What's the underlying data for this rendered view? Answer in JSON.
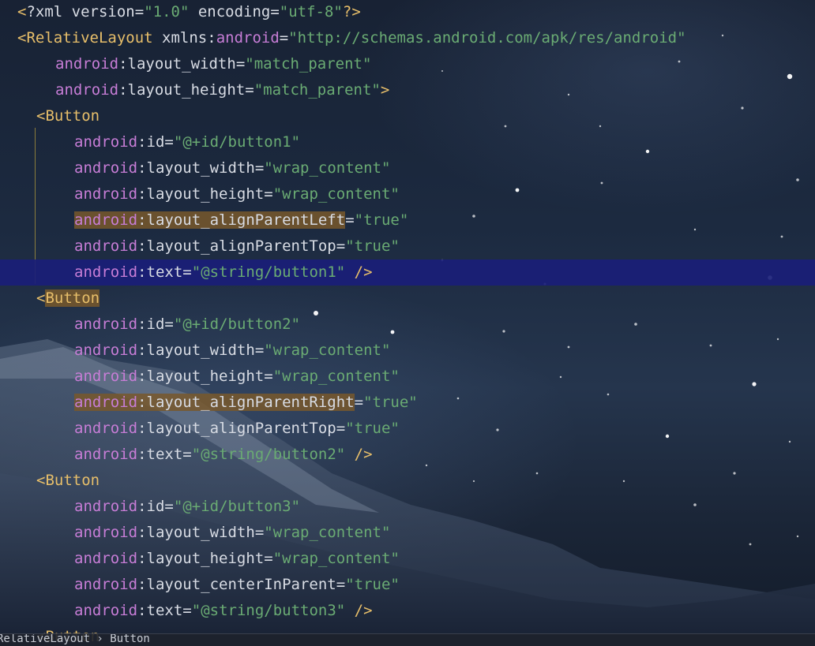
{
  "editor": {
    "lines": [
      [
        [
          "tk-bracket",
          "<"
        ],
        [
          "tk-plain",
          "?xml version"
        ],
        [
          "tk-punct",
          "="
        ],
        [
          "tk-str",
          "\"1.0\""
        ],
        [
          "tk-plain",
          " encoding"
        ],
        [
          "tk-punct",
          "="
        ],
        [
          "tk-str",
          "\"utf-8\""
        ],
        [
          "tk-bracket",
          "?>"
        ]
      ],
      [
        [
          "tk-bracket",
          "<"
        ],
        [
          "tk-tag",
          "RelativeLayout"
        ],
        [
          "tk-plain",
          " xmlns"
        ],
        [
          "tk-punct",
          ":"
        ],
        [
          "tk-ns",
          "android"
        ],
        [
          "tk-punct",
          "="
        ],
        [
          "tk-str",
          "\"http://schemas.android.com/apk/res/android\""
        ]
      ],
      [
        [
          "tk-ns",
          "android"
        ],
        [
          "tk-punct",
          ":"
        ],
        [
          "tk-attr",
          "layout_width"
        ],
        [
          "tk-punct",
          "="
        ],
        [
          "tk-str",
          "\"match_parent\""
        ]
      ],
      [
        [
          "tk-ns",
          "android"
        ],
        [
          "tk-punct",
          ":"
        ],
        [
          "tk-attr",
          "layout_height"
        ],
        [
          "tk-punct",
          "="
        ],
        [
          "tk-str",
          "\"match_parent\""
        ],
        [
          "tk-bracket",
          ">"
        ]
      ],
      [
        [
          "tk-bracket",
          "<"
        ],
        [
          "tk-tag",
          "Button"
        ]
      ],
      [
        [
          "tk-ns",
          "android"
        ],
        [
          "tk-punct",
          ":"
        ],
        [
          "tk-attr",
          "id"
        ],
        [
          "tk-punct",
          "="
        ],
        [
          "tk-str",
          "\"@+id/button1\""
        ]
      ],
      [
        [
          "tk-ns",
          "android"
        ],
        [
          "tk-punct",
          ":"
        ],
        [
          "tk-attr",
          "layout_width"
        ],
        [
          "tk-punct",
          "="
        ],
        [
          "tk-str",
          "\"wrap_content\""
        ]
      ],
      [
        [
          "tk-ns",
          "android"
        ],
        [
          "tk-punct",
          ":"
        ],
        [
          "tk-attr",
          "layout_height"
        ],
        [
          "tk-punct",
          "="
        ],
        [
          "tk-str",
          "\"wrap_content\""
        ]
      ],
      [
        [
          "tk-ns hl",
          "android"
        ],
        [
          "tk-punct hl",
          ":"
        ],
        [
          "tk-attr hl",
          "layout_alignParentLeft"
        ],
        [
          "tk-punct",
          "="
        ],
        [
          "tk-str",
          "\"true\""
        ]
      ],
      [
        [
          "tk-ns",
          "android"
        ],
        [
          "tk-punct",
          ":"
        ],
        [
          "tk-attr",
          "layout_alignParentTop"
        ],
        [
          "tk-punct",
          "="
        ],
        [
          "tk-str",
          "\"true\""
        ]
      ],
      [
        [
          "tk-ns",
          "android"
        ],
        [
          "tk-punct",
          ":"
        ],
        [
          "tk-attr",
          "text"
        ],
        [
          "tk-punct",
          "="
        ],
        [
          "tk-str",
          "\"@string/button1\""
        ],
        [
          "tk-plain",
          " "
        ],
        [
          "tk-bracket",
          "/>"
        ]
      ],
      [
        [
          "tk-bracket",
          "<"
        ],
        [
          "tk-tag hl",
          "Button"
        ]
      ],
      [
        [
          "tk-ns",
          "android"
        ],
        [
          "tk-punct",
          ":"
        ],
        [
          "tk-attr",
          "id"
        ],
        [
          "tk-punct",
          "="
        ],
        [
          "tk-str",
          "\"@+id/button2\""
        ]
      ],
      [
        [
          "tk-ns",
          "android"
        ],
        [
          "tk-punct",
          ":"
        ],
        [
          "tk-attr",
          "layout_width"
        ],
        [
          "tk-punct",
          "="
        ],
        [
          "tk-str",
          "\"wrap_content\""
        ]
      ],
      [
        [
          "tk-ns",
          "android"
        ],
        [
          "tk-punct",
          ":"
        ],
        [
          "tk-attr",
          "layout_height"
        ],
        [
          "tk-punct",
          "="
        ],
        [
          "tk-str",
          "\"wrap_content\""
        ]
      ],
      [
        [
          "tk-ns hl",
          "android"
        ],
        [
          "tk-punct hl",
          ":"
        ],
        [
          "tk-attr hl",
          "layout_alignParentRight"
        ],
        [
          "tk-punct",
          "="
        ],
        [
          "tk-str",
          "\"true\""
        ]
      ],
      [
        [
          "tk-ns",
          "android"
        ],
        [
          "tk-punct",
          ":"
        ],
        [
          "tk-attr",
          "layout_alignParentTop"
        ],
        [
          "tk-punct",
          "="
        ],
        [
          "tk-str",
          "\"true\""
        ]
      ],
      [
        [
          "tk-ns",
          "android"
        ],
        [
          "tk-punct",
          ":"
        ],
        [
          "tk-attr",
          "text"
        ],
        [
          "tk-punct",
          "="
        ],
        [
          "tk-str",
          "\"@string/button2\""
        ],
        [
          "tk-plain",
          " "
        ],
        [
          "tk-bracket",
          "/>"
        ]
      ],
      [
        [
          "tk-bracket",
          "<"
        ],
        [
          "tk-tag",
          "Button"
        ]
      ],
      [
        [
          "tk-ns",
          "android"
        ],
        [
          "tk-punct",
          ":"
        ],
        [
          "tk-attr",
          "id"
        ],
        [
          "tk-punct",
          "="
        ],
        [
          "tk-str",
          "\"@+id/button3\""
        ]
      ],
      [
        [
          "tk-ns",
          "android"
        ],
        [
          "tk-punct",
          ":"
        ],
        [
          "tk-attr",
          "layout_width"
        ],
        [
          "tk-punct",
          "="
        ],
        [
          "tk-str",
          "\"wrap_content\""
        ]
      ],
      [
        [
          "tk-ns",
          "android"
        ],
        [
          "tk-punct",
          ":"
        ],
        [
          "tk-attr",
          "layout_height"
        ],
        [
          "tk-punct",
          "="
        ],
        [
          "tk-str",
          "\"wrap_content\""
        ]
      ],
      [
        [
          "tk-ns",
          "android"
        ],
        [
          "tk-punct",
          ":"
        ],
        [
          "tk-attr",
          "layout_centerInParent"
        ],
        [
          "tk-punct",
          "="
        ],
        [
          "tk-str",
          "\"true\""
        ]
      ],
      [
        [
          "tk-ns",
          "android"
        ],
        [
          "tk-punct",
          ":"
        ],
        [
          "tk-attr",
          "text"
        ],
        [
          "tk-punct",
          "="
        ],
        [
          "tk-str",
          "\"@string/button3\""
        ],
        [
          "tk-plain",
          " "
        ],
        [
          "tk-bracket",
          "/>"
        ]
      ],
      [
        [
          "tk-bracket",
          "<"
        ],
        [
          "tk-tag",
          "Button"
        ]
      ]
    ],
    "current_line_index": 10
  },
  "status_bar": {
    "breadcrumb": "RelativeLayout › Button"
  },
  "colors": {
    "current_line": "#1a1e78",
    "match_highlight": "#78582c",
    "tag": "#e8bf6a",
    "namespace": "#c77dd6",
    "string": "#6aab73",
    "text": "#d8dce4"
  }
}
